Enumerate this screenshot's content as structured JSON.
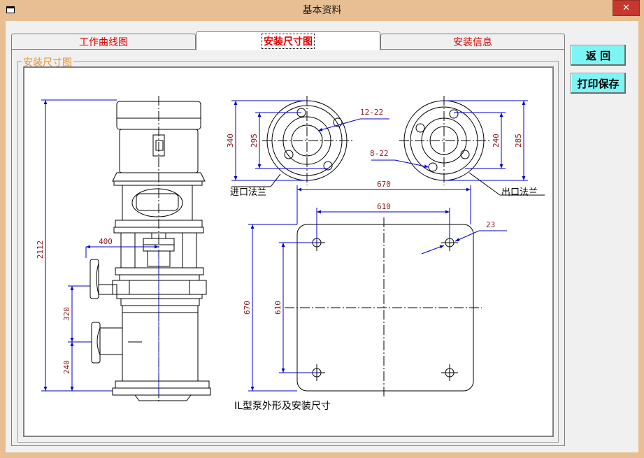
{
  "window": {
    "title": "基本资料"
  },
  "tabs": [
    {
      "label": "工作曲线图"
    },
    {
      "label": "安装尺寸图"
    },
    {
      "label": "安装信息"
    }
  ],
  "group": {
    "label": "安装尺寸图"
  },
  "buttons": {
    "back": "返  回",
    "print_save": "打印保存"
  },
  "drawing": {
    "caption": "IL型泵外形及安装尺寸",
    "inlet_label": "进口法兰",
    "outlet_label": "出口法兰",
    "dims": {
      "total_height": "2112",
      "arm": "400",
      "inlet_h": "320",
      "base_h": "240",
      "inlet_outer": "340",
      "inlet_bolt": "295",
      "inlet_holes": "12-22",
      "outlet_holes": "8-22",
      "outlet_bolt": "240",
      "outlet_outer": "285",
      "base_w": "670",
      "base_bolt_w": "610",
      "base_hole": "23",
      "base_d": "670",
      "base_bolt_d": "610"
    }
  }
}
